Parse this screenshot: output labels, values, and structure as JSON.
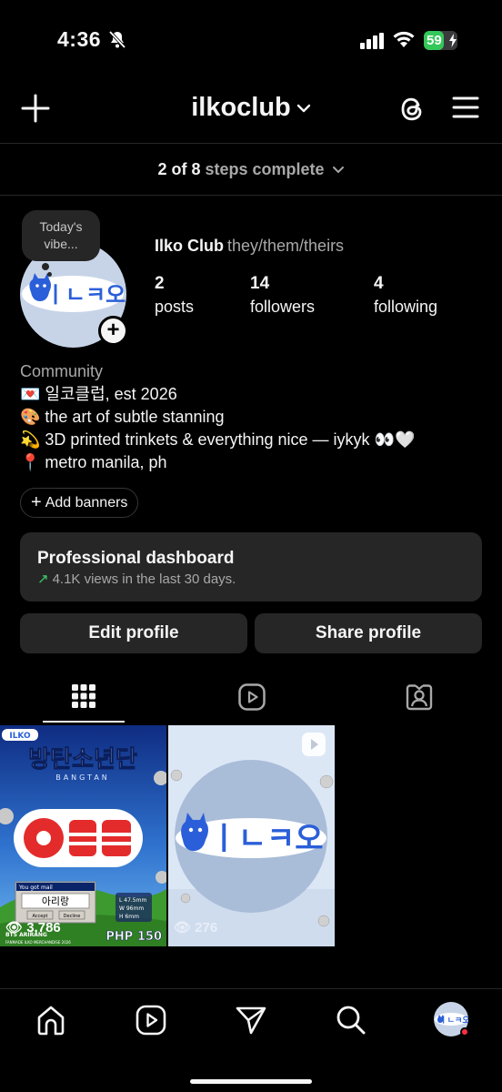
{
  "status_bar": {
    "time": "4:36",
    "battery": "59",
    "battery_level": 0.59
  },
  "header": {
    "username": "ilkoclub"
  },
  "steps": {
    "prefix": "2 of 8",
    "suffix": "steps complete"
  },
  "profile": {
    "vibe_note": "Today's vibe...",
    "display_name": "Ilko Club",
    "pronouns": "they/them/theirs",
    "stats": [
      {
        "value": "2",
        "label": "posts"
      },
      {
        "value": "14",
        "label": "followers"
      },
      {
        "value": "4",
        "label": "following"
      }
    ],
    "avatar_text": "ㅣㄴㅋ오"
  },
  "bio": {
    "category": "Community",
    "lines": [
      "💌 일코클럽, est 2026",
      "🎨 the art of subtle stanning",
      "💫 3D printed trinkets & everything nice — iykyk 👀🤍",
      "📍 metro manila, ph"
    ]
  },
  "add_banners_label": "Add banners",
  "dashboard": {
    "title": "Professional dashboard",
    "subtitle": "4.1K views in the last 30 days."
  },
  "buttons": {
    "edit": "Edit profile",
    "share": "Share profile"
  },
  "tabs": [
    {
      "icon": "grid-icon",
      "active": true
    },
    {
      "icon": "reels-icon",
      "active": false
    },
    {
      "icon": "tagged-icon",
      "active": false
    }
  ],
  "posts": [
    {
      "views": "3,786",
      "badge_text": "ILKO",
      "headline_korean": "방탄소년단",
      "headline_latin": "BANGTAN",
      "popup_title": "You got mail",
      "popup_text": "아리랑",
      "popup_accept": "Accept",
      "popup_decline": "Decline",
      "dims": [
        "L 47.5mm",
        "W 96mm",
        "H 6mm"
      ],
      "price": "PHP 150",
      "caption": "BTS ARIRANG",
      "footer": "FANMADE ILKO MERCHANDISE 2026"
    },
    {
      "views": "276",
      "logo_text": "ㅣㄴㅋ오"
    }
  ],
  "colors": {
    "background": "#000000",
    "surface": "#262626",
    "text": "#f5f5f5",
    "muted": "#a8a8a8",
    "accent_green": "#3ecf6b",
    "brand_blue": "#2b5fd9",
    "notification_red": "#ff3040"
  },
  "bottom_nav": [
    "home-icon",
    "reels-icon",
    "send-icon",
    "search-icon",
    "profile-avatar"
  ]
}
